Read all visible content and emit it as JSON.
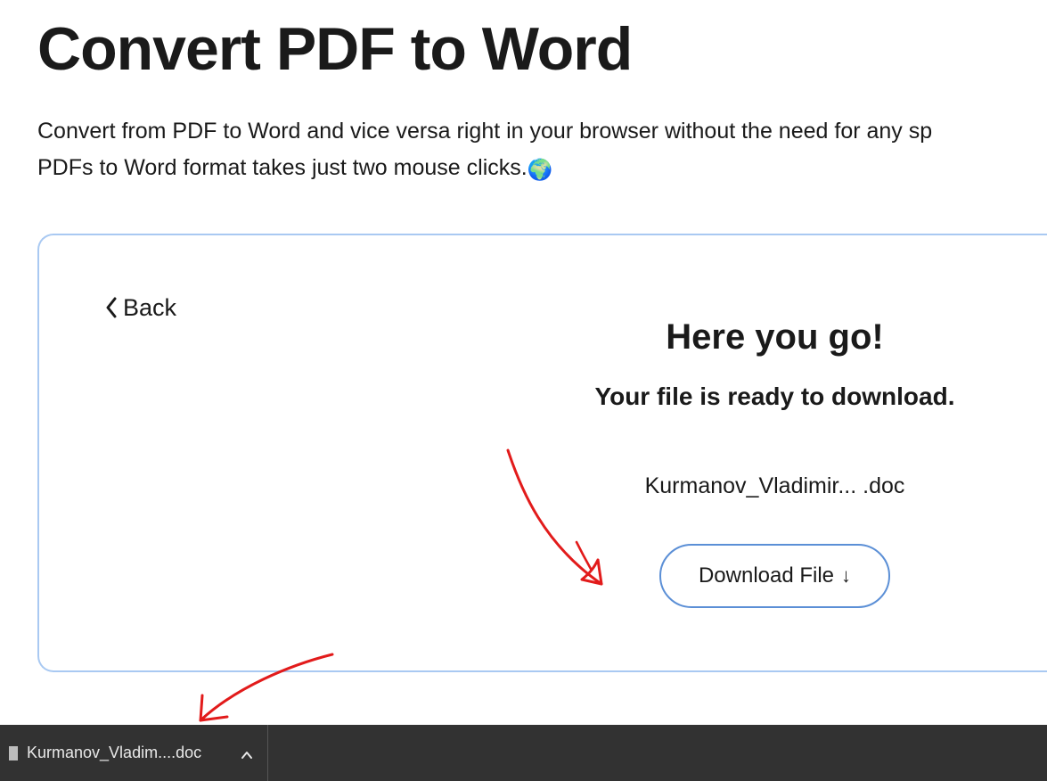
{
  "header": {
    "title": "Convert PDF to Word",
    "description_line1": "Convert from PDF to Word and vice versa right in your browser without the need for any sp",
    "description_line2_prefix": "PDFs to Word format takes just two mouse clicks.",
    "globe_emoji": "🌍"
  },
  "card": {
    "back_label": "Back",
    "result_heading": "Here you go!",
    "result_subheading": "Your file is ready to download.",
    "filename": "Kurmanov_Vladimir...  .doc",
    "download_label": "Download File",
    "download_arrow": "↓"
  },
  "download_shelf": {
    "filename": "Kurmanov_Vladim....doc"
  },
  "colors": {
    "card_border": "#a9c9f2",
    "button_border": "#5b8fd6",
    "annotation": "#e21b1b",
    "shelf_bg": "#323232"
  }
}
